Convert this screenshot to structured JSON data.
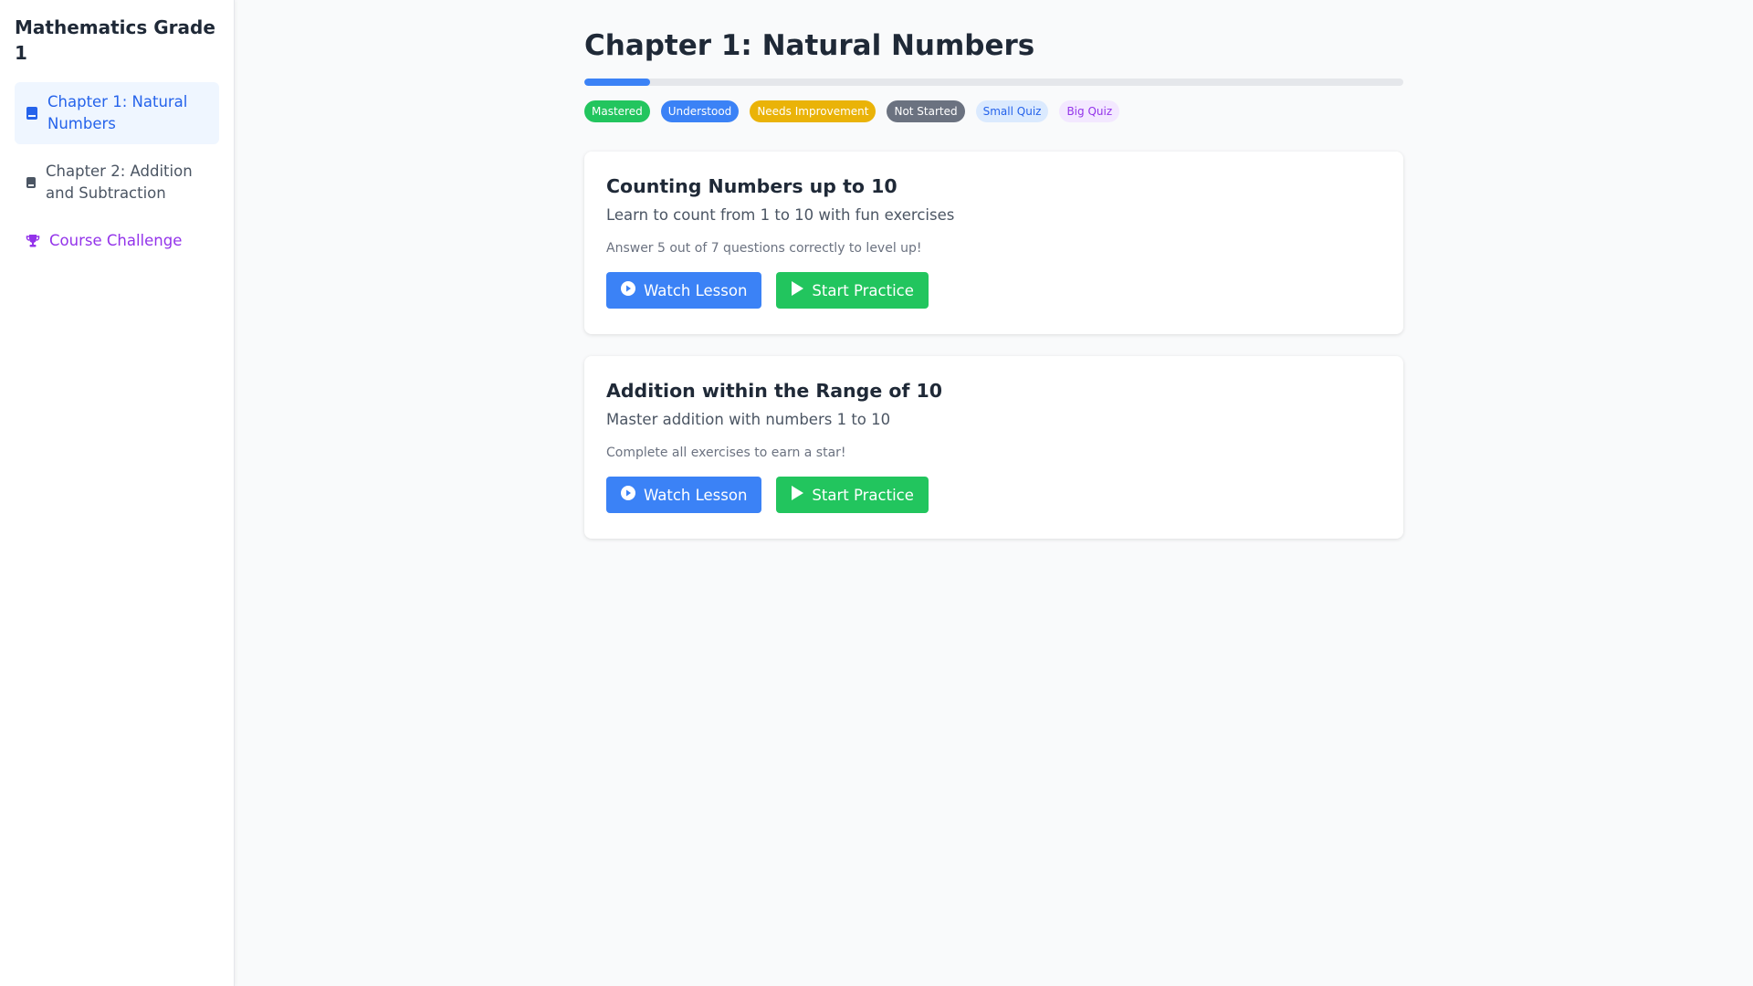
{
  "sidebar": {
    "title": "Mathematics Grade 1",
    "items": [
      {
        "label": "Chapter 1: Natural Numbers",
        "icon": "book-icon",
        "active": true
      },
      {
        "label": "Chapter 2: Addition and Subtraction",
        "icon": "book-icon",
        "active": false
      },
      {
        "label": "Course Challenge",
        "icon": "trophy-icon",
        "active": false
      }
    ]
  },
  "main": {
    "title": "Chapter 1: Natural Numbers",
    "progress": 0.08,
    "legend": [
      {
        "label": "Mastered",
        "color": "#22c55e"
      },
      {
        "label": "Understood",
        "color": "#3b82f6"
      },
      {
        "label": "Needs Improvement",
        "color": "#eab308"
      },
      {
        "label": "Not Started",
        "color": "#6b7280"
      },
      {
        "label": "Small Quiz",
        "color": "#dbeafe"
      },
      {
        "label": "Big Quiz",
        "color": "#f3e8ff"
      }
    ],
    "lessons": [
      {
        "title": "Counting Numbers up to 10",
        "description": "Learn to count from 1 to 10 with fun exercises",
        "hint": "Answer 5 out of 7 questions correctly to level up!",
        "watch_label": "Watch Lesson",
        "practice_label": "Start Practice"
      },
      {
        "title": "Addition within the Range of 10",
        "description": "Master addition with numbers 1 to 10",
        "hint": "Complete all exercises to earn a star!",
        "watch_label": "Watch Lesson",
        "practice_label": "Start Practice"
      }
    ]
  },
  "colors": {
    "accent_blue": "#3b82f6",
    "accent_green": "#22c55e",
    "challenge_purple": "#9333ea"
  }
}
